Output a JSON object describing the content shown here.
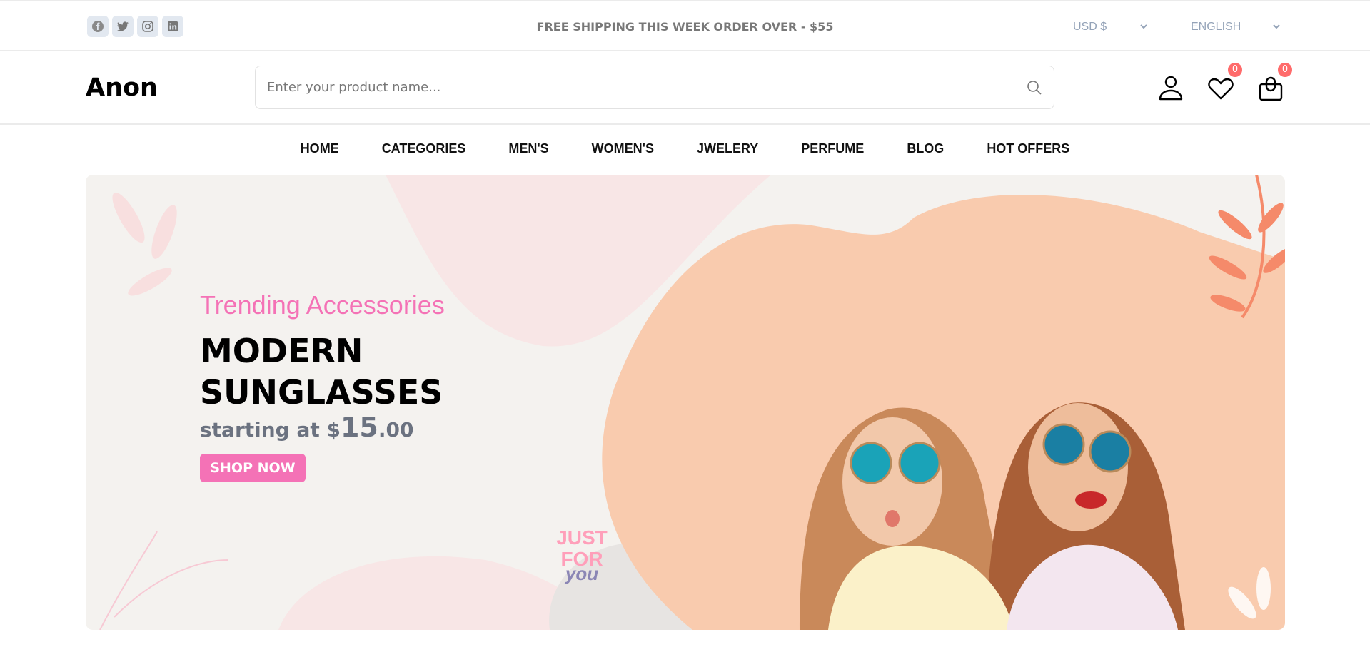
{
  "topbar": {
    "social": [
      "facebook-icon",
      "twitter-icon",
      "instagram-icon",
      "linkedin-icon"
    ],
    "shipping_text": "FREE SHIPPING THIS WEEK ORDER OVER - $55",
    "currency": "USD $",
    "language": "ENGLISH"
  },
  "header": {
    "logo": "Anon",
    "search_placeholder": "Enter your product name...",
    "wishlist_count": "0",
    "cart_count": "0"
  },
  "nav": {
    "items": [
      "HOME",
      "CATEGORIES",
      "MEN'S",
      "WOMEN'S",
      "JWELERY",
      "PERFUME",
      "BLOG",
      "HOT OFFERS"
    ]
  },
  "banner": {
    "subtitle": "Trending Accessories",
    "title": "MODERN SUNGLASSES",
    "price_prefix": "starting at $",
    "price_main": "15",
    "price_cents": ".00",
    "button": "SHOP NOW",
    "stamp": {
      "line1": "JUST",
      "line2": "FOR",
      "line3": "you"
    }
  },
  "colors": {
    "accent": "#f472b6",
    "badge": "#ff6b6b",
    "banner_bg": "#f4f2ef"
  }
}
